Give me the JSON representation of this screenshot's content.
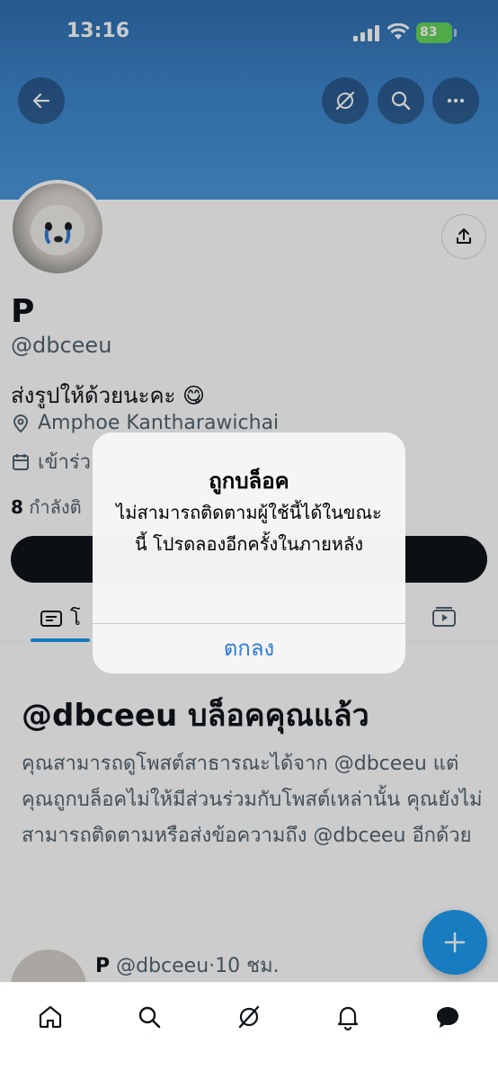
{
  "status_bar": {
    "time": "13:16",
    "battery": "83"
  },
  "header": {
    "back_icon": "arrow-left-icon",
    "grok_icon": "grok-icon",
    "search_icon": "search-icon",
    "more_icon": "more-icon"
  },
  "profile": {
    "name": "P",
    "handle": "@dbceeu",
    "bio": "ส่งรูปให้ด้วยนะคะ 😋",
    "location": "Amphoe Kantharawichai",
    "joined": "เข้าร่ว",
    "following_count": "8",
    "following_label": "กำลังติ"
  },
  "tabs": {
    "posts_label": "โ"
  },
  "blocked": {
    "title": "@dbceeu บล็อคคุณแล้ว",
    "body": "คุณสามารถดูโพสต์สาธารณะได้จาก @dbceeu แต่คุณถูกบล็อคไม่ให้มีส่วนร่วมกับโพสต์เหล่านั้น คุณยังไม่สามารถติดตามหรือส่งข้อความถึง @dbceeu อีกด้วย"
  },
  "post_preview": {
    "name": "P",
    "handle": "@dbceeu",
    "sep": "·",
    "time": "10 ชม."
  },
  "alert": {
    "title": "ถูกบล็อค",
    "message": "ไม่สามารถติดตามผู้ใช้นี้ได้ในขณะนี้ โปรดลองอีกครั้งในภายหลัง",
    "ok_label": "ตกลง"
  },
  "colors": {
    "accent": "#1d9bf0",
    "alert_button": "#2f7bd8",
    "banner": "#3e86cc"
  }
}
